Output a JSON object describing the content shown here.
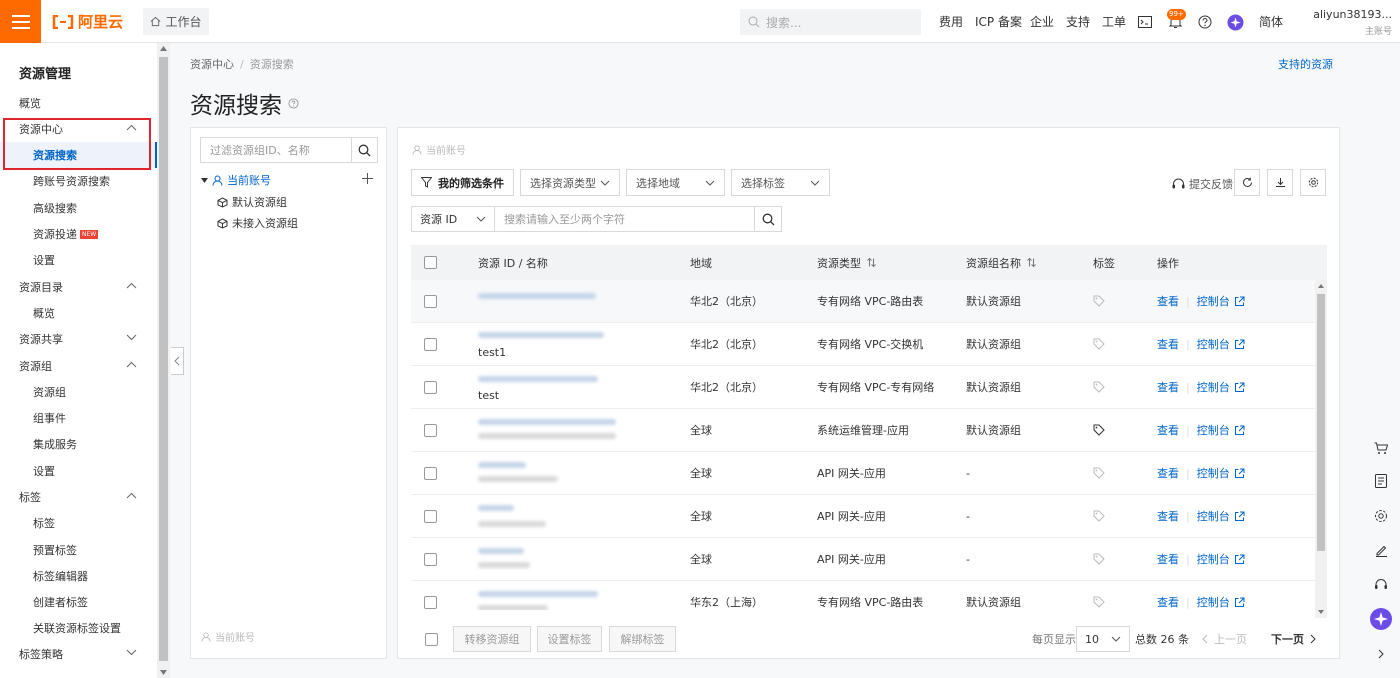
{
  "topbar": {
    "logo_text": "阿里云",
    "workbench": "工作台",
    "search_placeholder": "搜索...",
    "nav": [
      "费用",
      "ICP 备案",
      "企业",
      "支持",
      "工单"
    ],
    "notification_badge": "99+",
    "language": "简体",
    "user_name": "aliyun38193...",
    "user_role": "主账号"
  },
  "sidebar": {
    "title": "资源管理",
    "items": [
      {
        "label": "概览"
      },
      {
        "label": "资源中心"
      },
      {
        "label": "资源搜索"
      },
      {
        "label": "跨账号资源搜索"
      },
      {
        "label": "高级搜索"
      },
      {
        "label": "资源投递",
        "badge": "NEW"
      },
      {
        "label": "设置"
      },
      {
        "label": "资源目录"
      },
      {
        "label": "概览"
      },
      {
        "label": "资源共享"
      },
      {
        "label": "资源组"
      },
      {
        "label": "资源组"
      },
      {
        "label": "组事件"
      },
      {
        "label": "集成服务"
      },
      {
        "label": "设置"
      },
      {
        "label": "标签"
      },
      {
        "label": "标签"
      },
      {
        "label": "预置标签"
      },
      {
        "label": "标签编辑器"
      },
      {
        "label": "创建者标签"
      },
      {
        "label": "关联资源标签设置"
      },
      {
        "label": "标签策略"
      }
    ]
  },
  "breadcrumb": {
    "root": "资源中心",
    "current": "资源搜索"
  },
  "supported_link": "支持的资源",
  "page_title": "资源搜索",
  "left_panel": {
    "search_placeholder": "过滤资源组ID、名称",
    "tree_root": "当前账号",
    "tree_children": [
      "默认资源组",
      "未接入资源组"
    ],
    "footer": "当前账号"
  },
  "main": {
    "account_label": "当前账号",
    "filters": {
      "my_filters": "我的筛选条件",
      "resource_type": "选择资源类型",
      "region": "选择地域",
      "tag": "选择标签"
    },
    "feedback": "提交反馈",
    "id_select": "资源 ID",
    "id_placeholder": "搜索请输入至少两个字符",
    "columns": [
      "资源 ID / 名称",
      "地域",
      "资源类型",
      "资源组名称",
      "标签",
      "操作"
    ],
    "rows": [
      {
        "name": "",
        "region": "华北2（北京）",
        "type": "专有网络 VPC-路由表",
        "group": "默认资源组",
        "view": "查看",
        "console": "控制台"
      },
      {
        "name": "test1",
        "region": "华北2（北京）",
        "type": "专有网络 VPC-交换机",
        "group": "默认资源组",
        "view": "查看",
        "console": "控制台"
      },
      {
        "name": "test",
        "region": "华北2（北京）",
        "type": "专有网络 VPC-专有网络",
        "group": "默认资源组",
        "view": "查看",
        "console": "控制台"
      },
      {
        "name": "",
        "region": "全球",
        "type": "系统运维管理-应用",
        "group": "默认资源组",
        "view": "查看",
        "console": "控制台"
      },
      {
        "name": "",
        "region": "全球",
        "type": "API 网关-应用",
        "group": "-",
        "view": "查看",
        "console": "控制台"
      },
      {
        "name": "",
        "region": "全球",
        "type": "API 网关-应用",
        "group": "-",
        "view": "查看",
        "console": "控制台"
      },
      {
        "name": "",
        "region": "全球",
        "type": "API 网关-应用",
        "group": "-",
        "view": "查看",
        "console": "控制台"
      },
      {
        "name": "",
        "region": "华东2（上海）",
        "type": "专有网络 VPC-路由表",
        "group": "默认资源组",
        "view": "查看",
        "console": "控制台"
      }
    ],
    "bulk": [
      "转移资源组",
      "设置标签",
      "解绑标签"
    ],
    "pagination": {
      "per_page_label": "每页显示",
      "per_page": "10",
      "total": "总数 26 条",
      "prev": "上一页",
      "next": "下一页"
    }
  },
  "colors": {
    "brand": "#ff6a00",
    "link": "#0064c8",
    "highlight_box": "#e0252b"
  }
}
